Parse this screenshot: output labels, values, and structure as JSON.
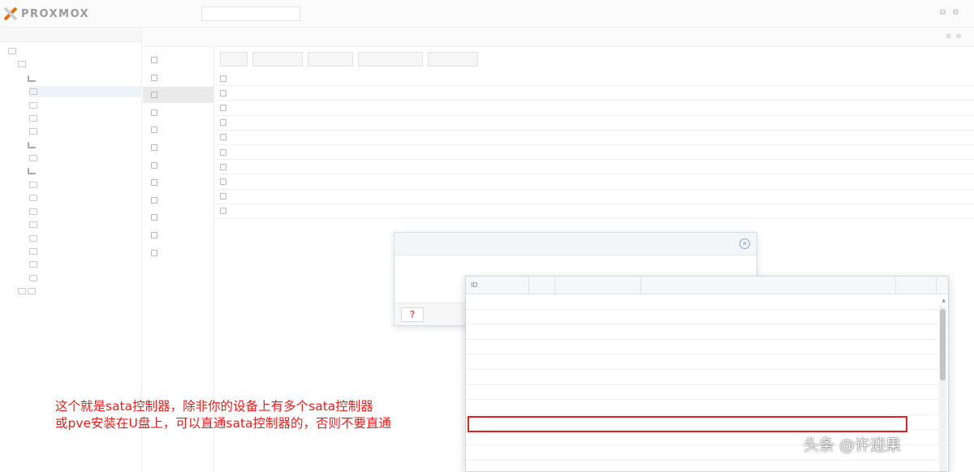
{
  "header": {
    "logo_text": "PROXMOX",
    "version": "",
    "search_placeholder": "",
    "crumb": ""
  },
  "tree": {
    "view_label": "",
    "items": [
      {
        "label": ""
      },
      {
        "label": ""
      },
      {
        "label": ""
      },
      {
        "label": ""
      },
      {
        "label": ""
      },
      {
        "label": ""
      },
      {
        "label": ""
      },
      {
        "label": ""
      },
      {
        "label": ""
      },
      {
        "label": ""
      },
      {
        "label": ""
      },
      {
        "label": ""
      },
      {
        "label": ""
      },
      {
        "label": ""
      },
      {
        "label": ""
      },
      {
        "label": ""
      },
      {
        "label": ""
      },
      {
        "label": ""
      },
      {
        "label": ""
      },
      {
        "label": ""
      }
    ]
  },
  "subnav": {
    "items": [
      {
        "label": ""
      },
      {
        "label": ""
      },
      {
        "label": ""
      },
      {
        "label": ""
      },
      {
        "label": ""
      },
      {
        "label": ""
      },
      {
        "label": ""
      },
      {
        "label": ""
      },
      {
        "label": ""
      },
      {
        "label": ""
      },
      {
        "label": ""
      },
      {
        "label": ""
      }
    ],
    "active_index": 2
  },
  "toolbar": {
    "buttons": [
      {
        "label": ""
      },
      {
        "label": ""
      },
      {
        "label": ""
      },
      {
        "label": ""
      },
      {
        "label": ""
      }
    ]
  },
  "hardware": {
    "rows": [
      {
        "name": "",
        "value": ""
      },
      {
        "name": "",
        "value": ""
      },
      {
        "name": "",
        "value": ""
      },
      {
        "name": "",
        "value": ""
      },
      {
        "name": "",
        "value": ""
      },
      {
        "name": "",
        "value": ""
      },
      {
        "name": "",
        "value": ""
      },
      {
        "name": "",
        "value": ""
      },
      {
        "name": "",
        "value": ""
      },
      {
        "name": "",
        "value": ""
      }
    ]
  },
  "dialog": {
    "title": "",
    "device_label": "",
    "mdev_label": "",
    "device_value": "",
    "help_label": ""
  },
  "device_list": {
    "columns": {
      "id": "ID",
      "iommu": "",
      "vendor": "",
      "device": "",
      "mdev": ""
    },
    "rows": [
      {
        "id": "",
        "iommu": "",
        "vendor": "",
        "device": "",
        "mdev": ""
      },
      {
        "id": "",
        "iommu": "",
        "vendor": "",
        "device": "",
        "mdev": ""
      },
      {
        "id": "",
        "iommu": "",
        "vendor": "",
        "device": "",
        "mdev": ""
      },
      {
        "id": "",
        "iommu": "",
        "vendor": "",
        "device": "",
        "mdev": ""
      },
      {
        "id": "",
        "iommu": "",
        "vendor": "",
        "device": "",
        "mdev": ""
      },
      {
        "id": "",
        "iommu": "",
        "vendor": "",
        "device": "",
        "mdev": ""
      },
      {
        "id": "",
        "iommu": "",
        "vendor": "",
        "device": "",
        "mdev": ""
      },
      {
        "id": "",
        "iommu": "",
        "vendor": "",
        "device": "",
        "mdev": ""
      },
      {
        "id": "",
        "iommu": "",
        "vendor": "",
        "device": "",
        "mdev": ""
      },
      {
        "id": "",
        "iommu": "",
        "vendor": "",
        "device": "",
        "mdev": ""
      },
      {
        "id": "",
        "iommu": "",
        "vendor": "",
        "device": "",
        "mdev": ""
      }
    ],
    "highlighted_index": 8
  },
  "annotation": {
    "line1": "这个就是sata控制器，除非你的设备上有多个sata控制器",
    "line2": "或pve安装在U盘上，可以直通sata控制器的，否则不要直通"
  },
  "watermark": "头条 @许迎果",
  "colors": {
    "accent_orange": "#e57000",
    "annotation_red": "#e41e1e",
    "dialog_title": "#6d8bb0"
  }
}
